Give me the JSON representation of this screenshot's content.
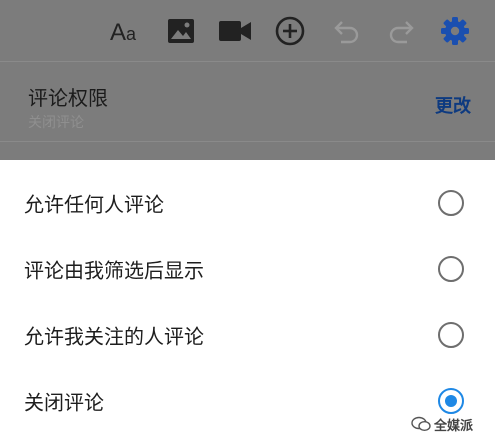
{
  "toolbar": {
    "icons": [
      "text-format-icon",
      "image-icon",
      "video-icon",
      "add-circle-icon",
      "undo-icon",
      "redo-icon",
      "settings-gear-icon"
    ],
    "gear_color": "#1a73e8",
    "icon_color": "#222222",
    "disabled_icon_color": "#9a9a9a"
  },
  "permission": {
    "title": "评论权限",
    "current_value": "关闭评论",
    "change_label": "更改"
  },
  "sheet": {
    "options": [
      {
        "label": "允许任何人评论",
        "selected": false
      },
      {
        "label": "评论由我筛选后显示",
        "selected": false
      },
      {
        "label": "允许我关注的人评论",
        "selected": false
      },
      {
        "label": "关闭评论",
        "selected": true
      }
    ],
    "accent_color": "#1e88e5"
  },
  "watermark": {
    "text": "全媒派"
  }
}
